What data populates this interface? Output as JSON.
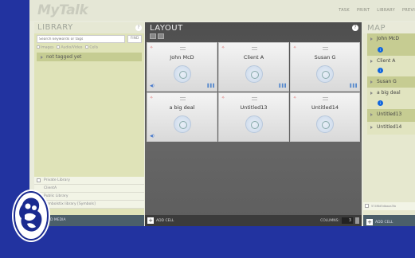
{
  "app": {
    "logo": "MyTalk",
    "nav": [
      "TASK",
      "PRINT",
      "LIBRARY",
      "PREVI"
    ]
  },
  "library": {
    "title": "LIBRARY",
    "help": "?",
    "search_placeholder": "Search keywords or tags",
    "find_label": "FIND",
    "filters": [
      "Images",
      "Audio/Video",
      "Cells"
    ],
    "tag_item": "not tagged yet",
    "sections": [
      "Private Library",
      "ClientA",
      "Public Library",
      "Symbolstix library [Symbols]"
    ],
    "bottom_label": "D MEDIA"
  },
  "layout": {
    "title": "LAYOUT",
    "help": "?",
    "cells": [
      {
        "label": "John McD",
        "audio": true,
        "eq": true
      },
      {
        "label": "Client A",
        "audio": false,
        "eq": true
      },
      {
        "label": "Susan G",
        "audio": false,
        "eq": true
      },
      {
        "label": "a big deal",
        "audio": true,
        "eq": false
      },
      {
        "label": "Untitled13",
        "audio": false,
        "eq": false
      },
      {
        "label": "Untitled14",
        "audio": false,
        "eq": false
      }
    ],
    "add_cell": "ADD CELL",
    "columns_label": "COLUMNS:",
    "columns_value": "3"
  },
  "map": {
    "title": "MAP",
    "items": [
      {
        "label": "John McD",
        "bullet": true
      },
      {
        "label": "Client A",
        "bullet": true
      },
      {
        "label": "Susan G",
        "bullet": false
      },
      {
        "label": "a big deal",
        "bullet": true
      },
      {
        "label": "Untitled13",
        "bullet": false
      },
      {
        "label": "Untitled14",
        "bullet": false
      }
    ],
    "footer_id": "574f6d5dbaaa3fa",
    "add_cell": "ADD CELL"
  },
  "colors": {
    "background": "#2233a0",
    "accent_blue": "#1166dd",
    "library_green": "#c5cc92"
  }
}
